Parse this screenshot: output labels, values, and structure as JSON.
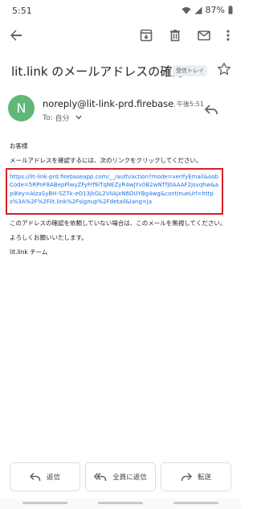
{
  "status_bar": {
    "time": "5:51",
    "battery": "87%"
  },
  "toolbar": {
    "back_icon": "arrow-back-icon",
    "archive_icon": "archive-icon",
    "delete_icon": "trash-icon",
    "mark_unread_icon": "mail-icon",
    "more_icon": "more-vert-icon"
  },
  "email": {
    "subject": "lit.link のメールアドレスの確認",
    "label": "受信トレイ",
    "sender": "noreply@lit-link-prd.firebase...",
    "time": "午後5:51",
    "to_prefix": "To:",
    "to_name": "自分",
    "avatar_letter": "N",
    "avatar_color": "#5fb878",
    "body": {
      "greeting": "お客様",
      "instruction": "メールアドレスを確認するには、次のリンクをクリックしてください。",
      "link": "https://lit-link-prd.firebaseapp.com/__/auth/action?mode=verifyEmail&oobCode=5RPnF8ABepPlwyZFyFrf9iTqNEZyR4wJYv0B2wNTfj0AAAF2jsvqhw&apiKey=AIzaSyBH-SZ7k-eO13jkGL2ViIAjxN6OUYBg4wg&continueUrl=https%3A%2F%2Flit.link%2Fsignup%2Fdetail&lang=ja",
      "ignore_note": "このアドレスの確認を依頼していない場合は、このメールを無視してください。",
      "regards": "よろしくお願いいたします。",
      "signature": "lit.link チーム"
    }
  },
  "actions": {
    "reply": "返信",
    "reply_all": "全員に返信",
    "forward": "転送"
  },
  "colors": {
    "highlight_border": "#d52027",
    "link": "#1a73e8"
  }
}
